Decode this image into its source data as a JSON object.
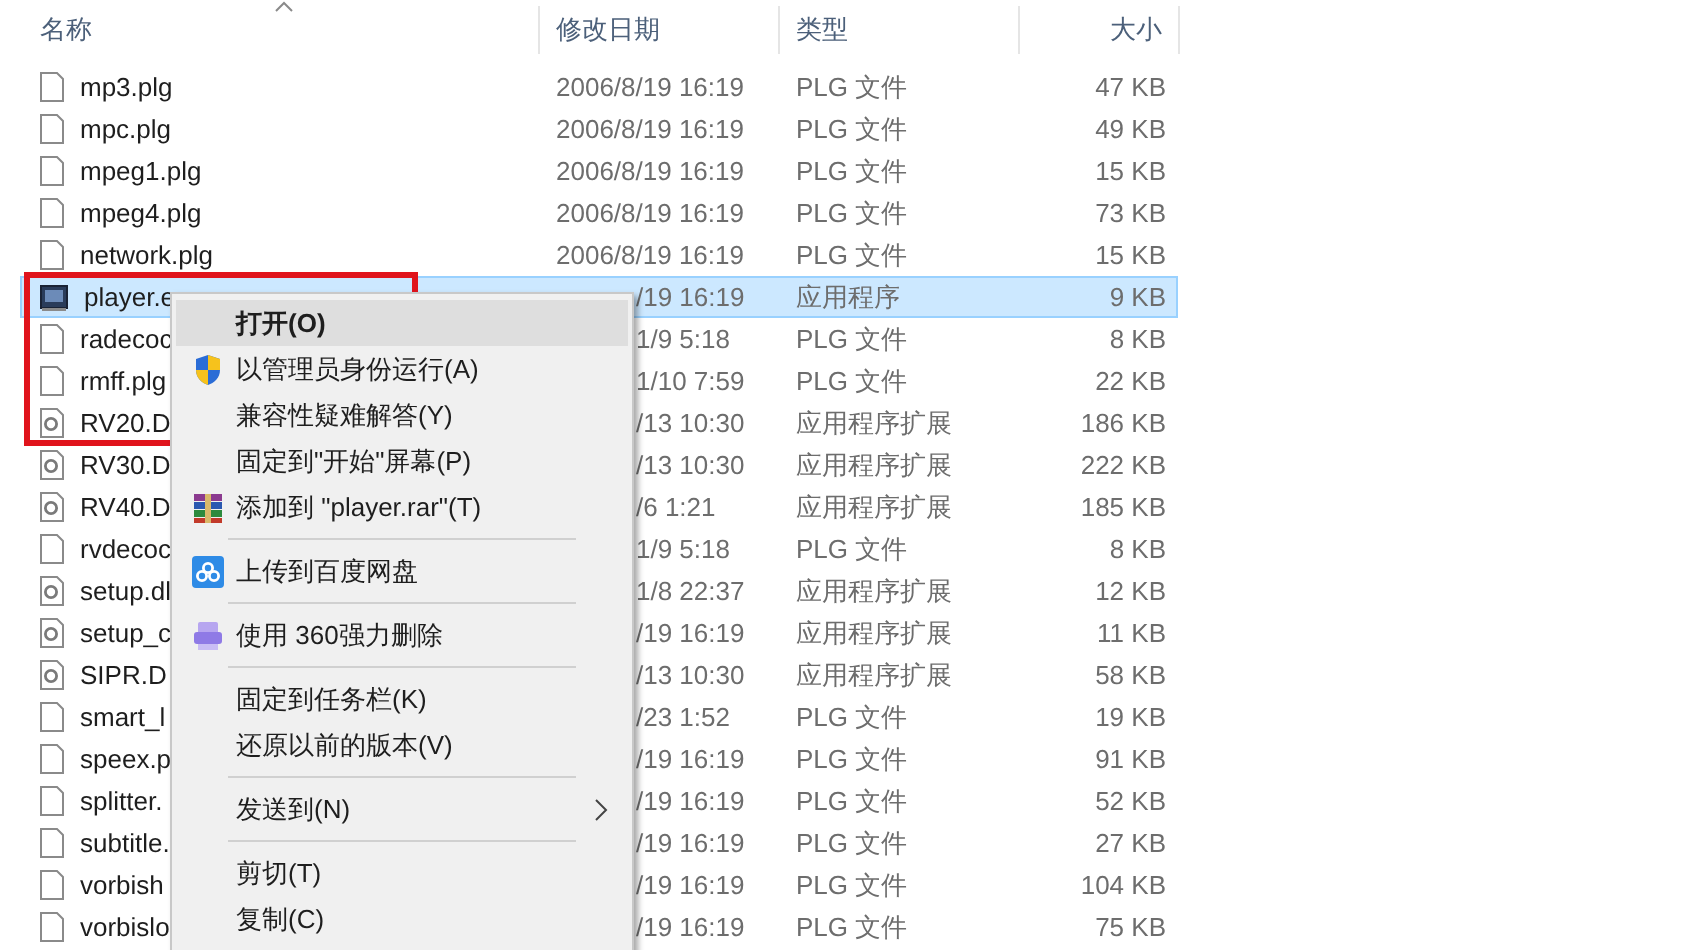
{
  "header": {
    "columns": [
      {
        "label": "名称",
        "sorted": true
      },
      {
        "label": "修改日期",
        "sorted": false
      },
      {
        "label": "类型",
        "sorted": false
      },
      {
        "label": "大小",
        "sorted": false
      }
    ]
  },
  "rows": [
    {
      "name": "mp3.plg",
      "kind": "plg",
      "date": "2006/8/19 16:19",
      "type": "PLG 文件",
      "size": "47 KB",
      "selected": false
    },
    {
      "name": "mpc.plg",
      "kind": "plg",
      "date": "2006/8/19 16:19",
      "type": "PLG 文件",
      "size": "49 KB",
      "selected": false
    },
    {
      "name": "mpeg1.plg",
      "kind": "plg",
      "date": "2006/8/19 16:19",
      "type": "PLG 文件",
      "size": "15 KB",
      "selected": false
    },
    {
      "name": "mpeg4.plg",
      "kind": "plg",
      "date": "2006/8/19 16:19",
      "type": "PLG 文件",
      "size": "73 KB",
      "selected": false
    },
    {
      "name": "network.plg",
      "kind": "plg",
      "date": "2006/8/19 16:19",
      "type": "PLG 文件",
      "size": "15 KB",
      "selected": false
    },
    {
      "name": "player.e",
      "kind": "exe",
      "date": "/19 16:19",
      "type": "应用程序",
      "size": "9 KB",
      "selected": true
    },
    {
      "name": "radecoc",
      "kind": "plg",
      "date": "1/9 5:18",
      "type": "PLG 文件",
      "size": "8 KB",
      "selected": false
    },
    {
      "name": "rmff.plg",
      "kind": "plg",
      "date": "1/10 7:59",
      "type": "PLG 文件",
      "size": "22 KB",
      "selected": false
    },
    {
      "name": "RV20.D",
      "kind": "dll",
      "date": "/13 10:30",
      "type": "应用程序扩展",
      "size": "186 KB",
      "selected": false
    },
    {
      "name": "RV30.D",
      "kind": "dll",
      "date": "/13 10:30",
      "type": "应用程序扩展",
      "size": "222 KB",
      "selected": false
    },
    {
      "name": "RV40.D",
      "kind": "dll",
      "date": "/6 1:21",
      "type": "应用程序扩展",
      "size": "185 KB",
      "selected": false
    },
    {
      "name": "rvdecoc",
      "kind": "plg",
      "date": "1/9 5:18",
      "type": "PLG 文件",
      "size": "8 KB",
      "selected": false
    },
    {
      "name": "setup.dl",
      "kind": "dll",
      "date": "1/8 22:37",
      "type": "应用程序扩展",
      "size": "12 KB",
      "selected": false
    },
    {
      "name": "setup_c",
      "kind": "dll",
      "date": "/19 16:19",
      "type": "应用程序扩展",
      "size": "11 KB",
      "selected": false
    },
    {
      "name": "SIPR.D",
      "kind": "dll",
      "date": "/13 10:30",
      "type": "应用程序扩展",
      "size": "58 KB",
      "selected": false
    },
    {
      "name": "smart_l",
      "kind": "plg",
      "date": "/23 1:52",
      "type": "PLG 文件",
      "size": "19 KB",
      "selected": false
    },
    {
      "name": "speex.p",
      "kind": "plg",
      "date": "/19 16:19",
      "type": "PLG 文件",
      "size": "91 KB",
      "selected": false
    },
    {
      "name": "splitter.",
      "kind": "plg",
      "date": "/19 16:19",
      "type": "PLG 文件",
      "size": "52 KB",
      "selected": false
    },
    {
      "name": "subtitle.",
      "kind": "plg",
      "date": "/19 16:19",
      "type": "PLG 文件",
      "size": "27 KB",
      "selected": false
    },
    {
      "name": "vorbish",
      "kind": "plg",
      "date": "/19 16:19",
      "type": "PLG 文件",
      "size": "104 KB",
      "selected": false
    },
    {
      "name": "vorbislo",
      "kind": "plg",
      "date": "/19 16:19",
      "type": "PLG 文件",
      "size": "75 KB",
      "selected": false
    }
  ],
  "context_menu": {
    "groups": [
      [
        {
          "label": "打开(O)",
          "kind": "plain",
          "default": true,
          "selected": true,
          "submenu": false
        },
        {
          "label": "以管理员身份运行(A)",
          "kind": "admin",
          "default": false,
          "selected": false,
          "submenu": false
        },
        {
          "label": "兼容性疑难解答(Y)",
          "kind": "plain",
          "default": false,
          "selected": false,
          "submenu": false
        },
        {
          "label": "固定到\"开始\"屏幕(P)",
          "kind": "plain",
          "default": false,
          "selected": false,
          "submenu": false
        },
        {
          "label": "添加到 \"player.rar\"(T)",
          "kind": "archive",
          "default": false,
          "selected": false,
          "submenu": false
        }
      ],
      [
        {
          "label": "上传到百度网盘",
          "kind": "cloud",
          "default": false,
          "selected": false,
          "submenu": false
        }
      ],
      [
        {
          "label": "使用 360强力删除",
          "kind": "shred",
          "default": false,
          "selected": false,
          "submenu": false
        }
      ],
      [
        {
          "label": "固定到任务栏(K)",
          "kind": "plain",
          "default": false,
          "selected": false,
          "submenu": false
        },
        {
          "label": "还原以前的版本(V)",
          "kind": "plain",
          "default": false,
          "selected": false,
          "submenu": false
        }
      ],
      [
        {
          "label": "发送到(N)",
          "kind": "plain",
          "default": false,
          "selected": false,
          "submenu": true
        }
      ],
      [
        {
          "label": "剪切(T)",
          "kind": "plain",
          "default": false,
          "selected": false,
          "submenu": false
        },
        {
          "label": "复制(C)",
          "kind": "plain",
          "default": false,
          "selected": false,
          "submenu": false
        }
      ]
    ]
  },
  "annotation": {
    "kind": "frame"
  }
}
